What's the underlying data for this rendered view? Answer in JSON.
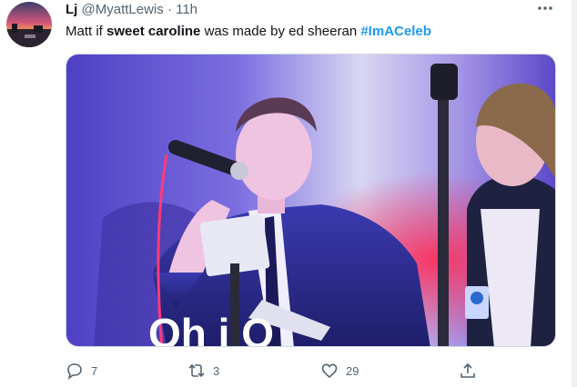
{
  "tweet": {
    "display_name": "Lj",
    "handle": "@MyattLewis",
    "separator": "·",
    "time": "11h",
    "text_part1": "Matt if ",
    "text_bold": "sweet caroline",
    "text_part2": " was made by ed sheeran ",
    "hashtag": "#ImACeleb",
    "media_caption_partial": "Oh i  O"
  },
  "actions": {
    "reply_count": "7",
    "retweet_count": "3",
    "like_count": "29",
    "share_label": ""
  },
  "colors": {
    "hashtag": "#1d9bf0",
    "muted": "#536471",
    "text": "#0f1419",
    "stage_purple": "#6a5bd6",
    "stage_magenta": "#e0306a"
  },
  "icons": {
    "more": "more-horizontal-icon",
    "reply": "reply-icon",
    "retweet": "retweet-icon",
    "like": "heart-icon",
    "share": "share-icon"
  }
}
